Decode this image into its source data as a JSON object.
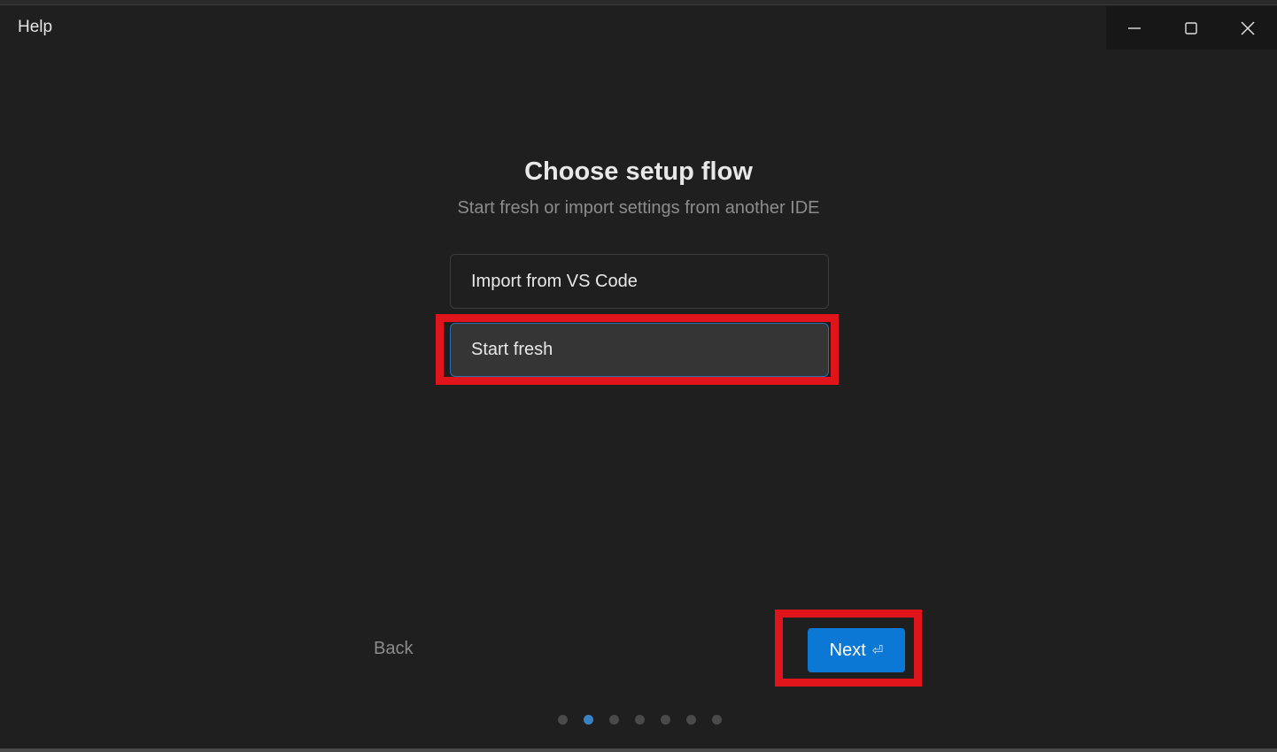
{
  "window": {
    "title": "Help",
    "controls": [
      "minimize-icon",
      "maximize-icon",
      "close-icon"
    ]
  },
  "main": {
    "heading": "Choose setup flow",
    "subheading": "Start fresh or import settings from another IDE",
    "options": [
      {
        "label": "Import from VS Code",
        "selected": false
      },
      {
        "label": "Start fresh",
        "selected": true
      }
    ]
  },
  "footer": {
    "back_label": "Back",
    "next_label": "Next",
    "next_icon": "enter-icon",
    "steps_total": 7,
    "current_step": 2
  },
  "colors": {
    "background": "#1f1f1f",
    "accent": "#0b78d6",
    "highlight": "#e0141b",
    "active_dot": "#3b82c4"
  }
}
